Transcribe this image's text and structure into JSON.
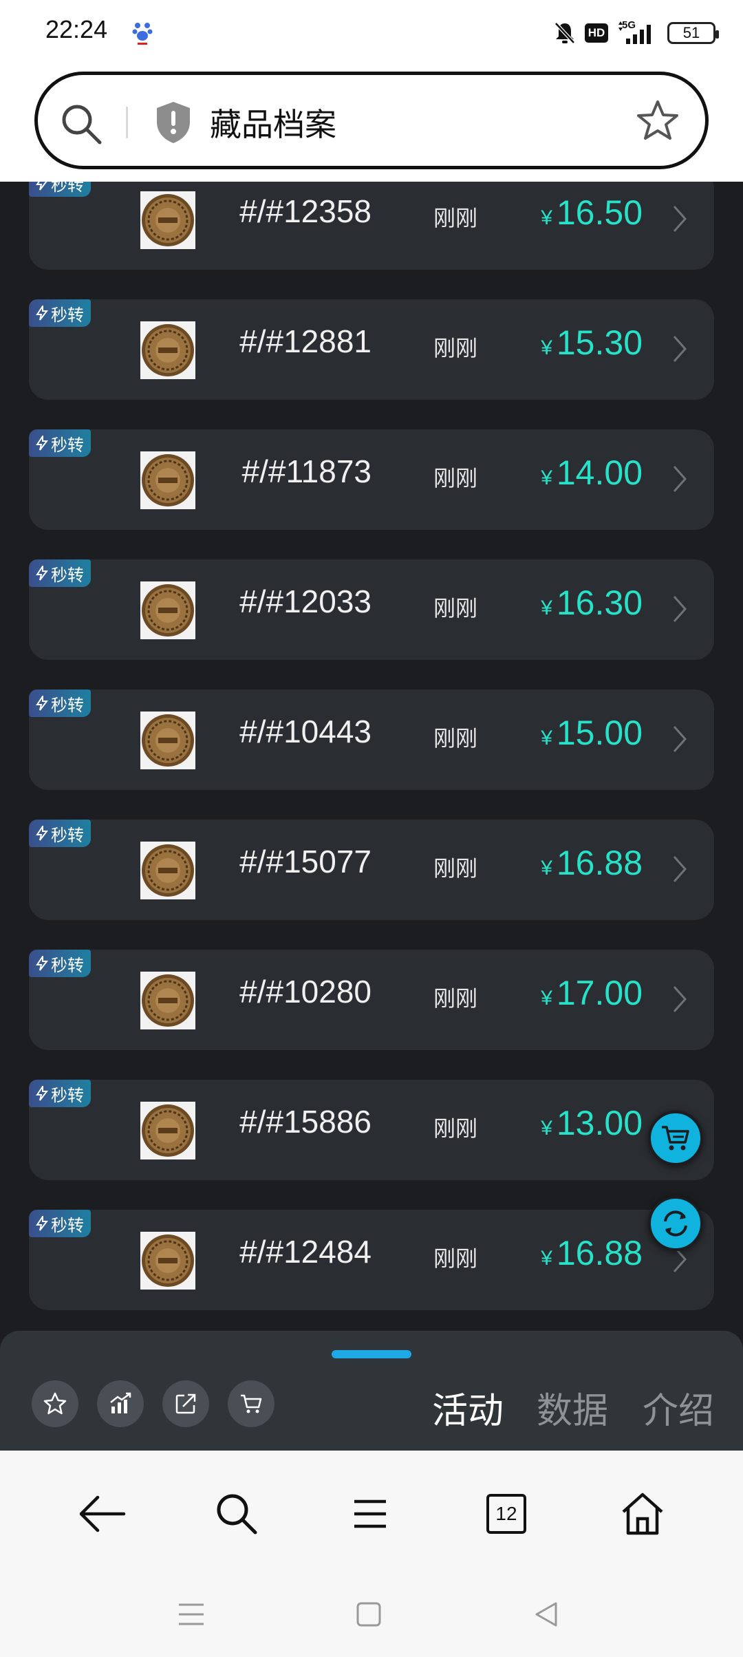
{
  "status_bar": {
    "time": "22:24",
    "hd_label": "HD",
    "network_label": "5G",
    "battery_level": "51"
  },
  "top_bar": {
    "title": "藏品档案"
  },
  "list": {
    "items": [
      {
        "badge": "秒转",
        "serial": "#/#12358",
        "time": "刚刚",
        "currency": "¥",
        "price": "16.50"
      },
      {
        "badge": "秒转",
        "serial": "#/#12881",
        "time": "刚刚",
        "currency": "¥",
        "price": "15.30"
      },
      {
        "badge": "秒转",
        "serial": "#/#11873",
        "time": "刚刚",
        "currency": "¥",
        "price": "14.00"
      },
      {
        "badge": "秒转",
        "serial": "#/#12033",
        "time": "刚刚",
        "currency": "¥",
        "price": "16.30"
      },
      {
        "badge": "秒转",
        "serial": "#/#10443",
        "time": "刚刚",
        "currency": "¥",
        "price": "15.00"
      },
      {
        "badge": "秒转",
        "serial": "#/#15077",
        "time": "刚刚",
        "currency": "¥",
        "price": "16.88"
      },
      {
        "badge": "秒转",
        "serial": "#/#10280",
        "time": "刚刚",
        "currency": "¥",
        "price": "17.00"
      },
      {
        "badge": "秒转",
        "serial": "#/#15886",
        "time": "刚刚",
        "currency": "¥",
        "price": "13.00"
      },
      {
        "badge": "秒转",
        "serial": "#/#12484",
        "time": "刚刚",
        "currency": "¥",
        "price": "16.88"
      }
    ]
  },
  "action_panel": {
    "icons": [
      "star-icon",
      "chart-icon",
      "share-icon",
      "cart-icon"
    ],
    "tabs": [
      {
        "label": "活动",
        "active": true
      },
      {
        "label": "数据",
        "active": false
      },
      {
        "label": "介绍",
        "active": false
      }
    ]
  },
  "browser_nav": {
    "tabs_count": "12"
  },
  "colors": {
    "accent_price": "#27e2c8",
    "fab": "#0fb3dd",
    "handle": "#1fa8e6",
    "card": "#2a2d31",
    "background": "#1b1d20"
  }
}
